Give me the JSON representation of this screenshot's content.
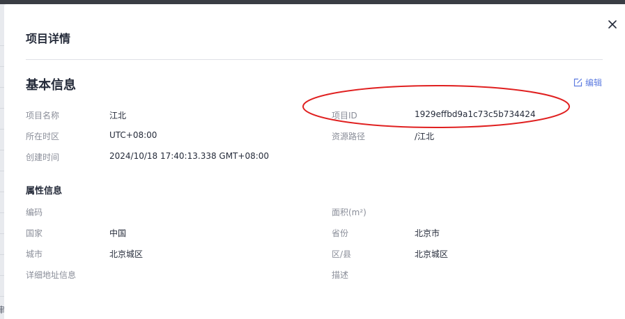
{
  "modal": {
    "title": "项目详情",
    "close_icon": "close-icon"
  },
  "basic_info": {
    "title": "基本信息",
    "edit_label": "编辑",
    "fields_left": [
      {
        "label": "项目名称",
        "value": "江北"
      },
      {
        "label": "所在时区",
        "value": "UTC+08:00"
      },
      {
        "label": "创建时间",
        "value": "2024/10/18 17:40:13.338 GMT+08:00"
      }
    ],
    "fields_right": [
      {
        "label": "项目ID",
        "value": "1929effbd9a1c73c5b734424"
      },
      {
        "label": "资源路径",
        "value": "/江北"
      }
    ]
  },
  "attribute_info": {
    "title": "属性信息",
    "fields_left": [
      {
        "label": "编码",
        "value": ""
      },
      {
        "label": "国家",
        "value": "中国"
      },
      {
        "label": "城市",
        "value": "北京城区"
      },
      {
        "label": "详细地址信息",
        "value": ""
      }
    ],
    "fields_right": [
      {
        "label": "面积(m²)",
        "value": ""
      },
      {
        "label": "省份",
        "value": "北京市"
      },
      {
        "label": "区/县",
        "value": "北京城区"
      },
      {
        "label": "描述",
        "value": ""
      }
    ]
  },
  "background": {
    "edge_glyph": "串"
  },
  "colors": {
    "accent": "#5e7ce0",
    "annotation": "#e02020",
    "label": "#8a8e99",
    "text": "#252b3a"
  }
}
